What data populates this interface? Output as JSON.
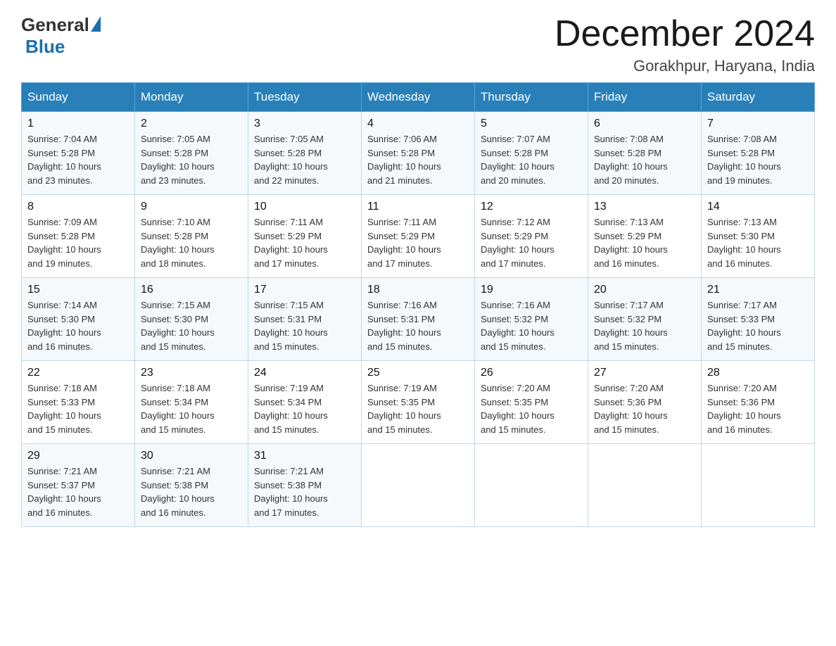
{
  "header": {
    "logo": {
      "general": "General",
      "blue": "Blue"
    },
    "title": "December 2024",
    "location": "Gorakhpur, Haryana, India"
  },
  "calendar": {
    "days": [
      "Sunday",
      "Monday",
      "Tuesday",
      "Wednesday",
      "Thursday",
      "Friday",
      "Saturday"
    ],
    "weeks": [
      [
        {
          "num": "1",
          "sunrise": "7:04 AM",
          "sunset": "5:28 PM",
          "daylight": "10 hours and 23 minutes."
        },
        {
          "num": "2",
          "sunrise": "7:05 AM",
          "sunset": "5:28 PM",
          "daylight": "10 hours and 23 minutes."
        },
        {
          "num": "3",
          "sunrise": "7:05 AM",
          "sunset": "5:28 PM",
          "daylight": "10 hours and 22 minutes."
        },
        {
          "num": "4",
          "sunrise": "7:06 AM",
          "sunset": "5:28 PM",
          "daylight": "10 hours and 21 minutes."
        },
        {
          "num": "5",
          "sunrise": "7:07 AM",
          "sunset": "5:28 PM",
          "daylight": "10 hours and 20 minutes."
        },
        {
          "num": "6",
          "sunrise": "7:08 AM",
          "sunset": "5:28 PM",
          "daylight": "10 hours and 20 minutes."
        },
        {
          "num": "7",
          "sunrise": "7:08 AM",
          "sunset": "5:28 PM",
          "daylight": "10 hours and 19 minutes."
        }
      ],
      [
        {
          "num": "8",
          "sunrise": "7:09 AM",
          "sunset": "5:28 PM",
          "daylight": "10 hours and 19 minutes."
        },
        {
          "num": "9",
          "sunrise": "7:10 AM",
          "sunset": "5:28 PM",
          "daylight": "10 hours and 18 minutes."
        },
        {
          "num": "10",
          "sunrise": "7:11 AM",
          "sunset": "5:29 PM",
          "daylight": "10 hours and 17 minutes."
        },
        {
          "num": "11",
          "sunrise": "7:11 AM",
          "sunset": "5:29 PM",
          "daylight": "10 hours and 17 minutes."
        },
        {
          "num": "12",
          "sunrise": "7:12 AM",
          "sunset": "5:29 PM",
          "daylight": "10 hours and 17 minutes."
        },
        {
          "num": "13",
          "sunrise": "7:13 AM",
          "sunset": "5:29 PM",
          "daylight": "10 hours and 16 minutes."
        },
        {
          "num": "14",
          "sunrise": "7:13 AM",
          "sunset": "5:30 PM",
          "daylight": "10 hours and 16 minutes."
        }
      ],
      [
        {
          "num": "15",
          "sunrise": "7:14 AM",
          "sunset": "5:30 PM",
          "daylight": "10 hours and 16 minutes."
        },
        {
          "num": "16",
          "sunrise": "7:15 AM",
          "sunset": "5:30 PM",
          "daylight": "10 hours and 15 minutes."
        },
        {
          "num": "17",
          "sunrise": "7:15 AM",
          "sunset": "5:31 PM",
          "daylight": "10 hours and 15 minutes."
        },
        {
          "num": "18",
          "sunrise": "7:16 AM",
          "sunset": "5:31 PM",
          "daylight": "10 hours and 15 minutes."
        },
        {
          "num": "19",
          "sunrise": "7:16 AM",
          "sunset": "5:32 PM",
          "daylight": "10 hours and 15 minutes."
        },
        {
          "num": "20",
          "sunrise": "7:17 AM",
          "sunset": "5:32 PM",
          "daylight": "10 hours and 15 minutes."
        },
        {
          "num": "21",
          "sunrise": "7:17 AM",
          "sunset": "5:33 PM",
          "daylight": "10 hours and 15 minutes."
        }
      ],
      [
        {
          "num": "22",
          "sunrise": "7:18 AM",
          "sunset": "5:33 PM",
          "daylight": "10 hours and 15 minutes."
        },
        {
          "num": "23",
          "sunrise": "7:18 AM",
          "sunset": "5:34 PM",
          "daylight": "10 hours and 15 minutes."
        },
        {
          "num": "24",
          "sunrise": "7:19 AM",
          "sunset": "5:34 PM",
          "daylight": "10 hours and 15 minutes."
        },
        {
          "num": "25",
          "sunrise": "7:19 AM",
          "sunset": "5:35 PM",
          "daylight": "10 hours and 15 minutes."
        },
        {
          "num": "26",
          "sunrise": "7:20 AM",
          "sunset": "5:35 PM",
          "daylight": "10 hours and 15 minutes."
        },
        {
          "num": "27",
          "sunrise": "7:20 AM",
          "sunset": "5:36 PM",
          "daylight": "10 hours and 15 minutes."
        },
        {
          "num": "28",
          "sunrise": "7:20 AM",
          "sunset": "5:36 PM",
          "daylight": "10 hours and 16 minutes."
        }
      ],
      [
        {
          "num": "29",
          "sunrise": "7:21 AM",
          "sunset": "5:37 PM",
          "daylight": "10 hours and 16 minutes."
        },
        {
          "num": "30",
          "sunrise": "7:21 AM",
          "sunset": "5:38 PM",
          "daylight": "10 hours and 16 minutes."
        },
        {
          "num": "31",
          "sunrise": "7:21 AM",
          "sunset": "5:38 PM",
          "daylight": "10 hours and 17 minutes."
        },
        null,
        null,
        null,
        null
      ]
    ],
    "labels": {
      "sunrise": "Sunrise:",
      "sunset": "Sunset:",
      "daylight": "Daylight:"
    }
  }
}
